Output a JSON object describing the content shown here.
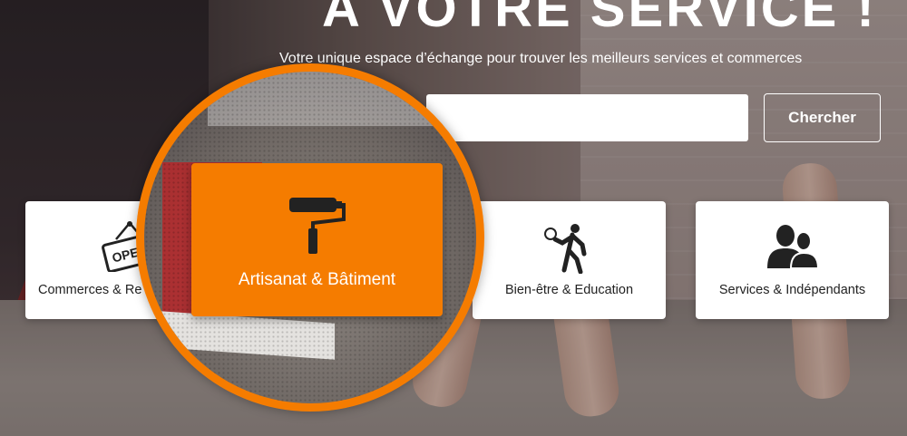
{
  "hero": {
    "title": "A VOTRE SERVICE !",
    "subtitle": "Votre unique espace d’échange pour trouver les meilleurs services et commerces"
  },
  "search": {
    "placeholder": "",
    "button_label": "Chercher"
  },
  "categories": [
    {
      "label": "Commerces & Re",
      "icon": "open-sign-icon"
    },
    {
      "label": "Artisanat & Bâtiment",
      "icon": "paint-roller-icon"
    },
    {
      "label": "Bien-être & Education",
      "icon": "tennis-player-icon"
    },
    {
      "label": "Services & Indépendants",
      "icon": "people-icon"
    }
  ],
  "colors": {
    "accent": "#f57c00",
    "card_bg": "#ffffff",
    "text_dark": "#222222"
  },
  "open_sign_text": "OPEN"
}
